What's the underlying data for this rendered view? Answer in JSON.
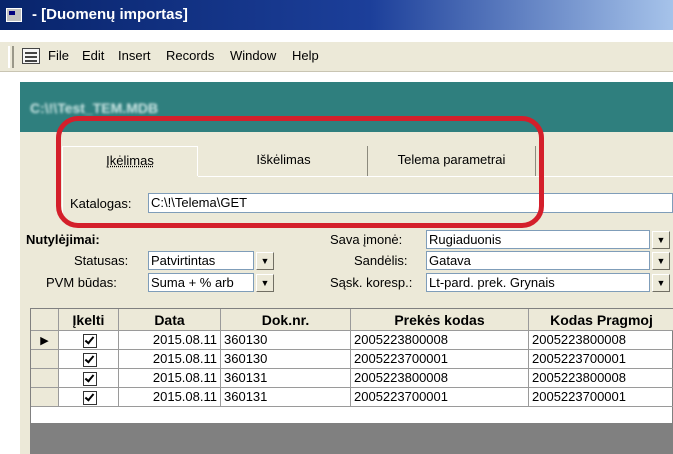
{
  "window": {
    "title": " - [Duomenų importas]"
  },
  "menu": [
    "File",
    "Edit",
    "Insert",
    "Records",
    "Window",
    "Help"
  ],
  "form": {
    "path_label": "C:\\!\\Test_TEM.MDB"
  },
  "tabs": [
    {
      "label": "Įkėlimas",
      "active": true
    },
    {
      "label": "Iškėlimas",
      "active": false
    },
    {
      "label": "Telema parametrai",
      "active": false
    }
  ],
  "katalogas": {
    "label": "Katalogas:",
    "value": "C:\\!\\Telema\\GET"
  },
  "defaults": {
    "title": "Nutylėjimai:",
    "statusas": {
      "label": "Statusas:",
      "value": "Patvirtintas"
    },
    "pvm": {
      "label": "PVM būdas:",
      "value": "Suma + % arb"
    },
    "imone": {
      "label": "Sava įmonė:",
      "value": "Rugiaduonis"
    },
    "sandelis": {
      "label": "Sandėlis:",
      "value": "Gatava"
    },
    "koresp": {
      "label": "Sąsk. koresp.:",
      "value": "Lt-pard. prek. Grynais"
    }
  },
  "table": {
    "columns": [
      "Įkelti",
      "Data",
      "Dok.nr.",
      "Prekės kodas",
      "Kodas Pragmoj"
    ],
    "rows": [
      {
        "checked": true,
        "data": "2015.08.11",
        "dok": "360130",
        "preke": "2005223800008",
        "kodas": "2005223800008"
      },
      {
        "checked": true,
        "data": "2015.08.11",
        "dok": "360130",
        "preke": "2005223700001",
        "kodas": "2005223700001"
      },
      {
        "checked": true,
        "data": "2015.08.11",
        "dok": "360131",
        "preke": "2005223800008",
        "kodas": "2005223800008"
      },
      {
        "checked": true,
        "data": "2015.08.11",
        "dok": "360131",
        "preke": "2005223700001",
        "kodas": "2005223700001"
      }
    ]
  },
  "colors": {
    "title_bar": "#08246b",
    "form_header": "#2f7f7e",
    "highlight": "#d41f2b"
  }
}
